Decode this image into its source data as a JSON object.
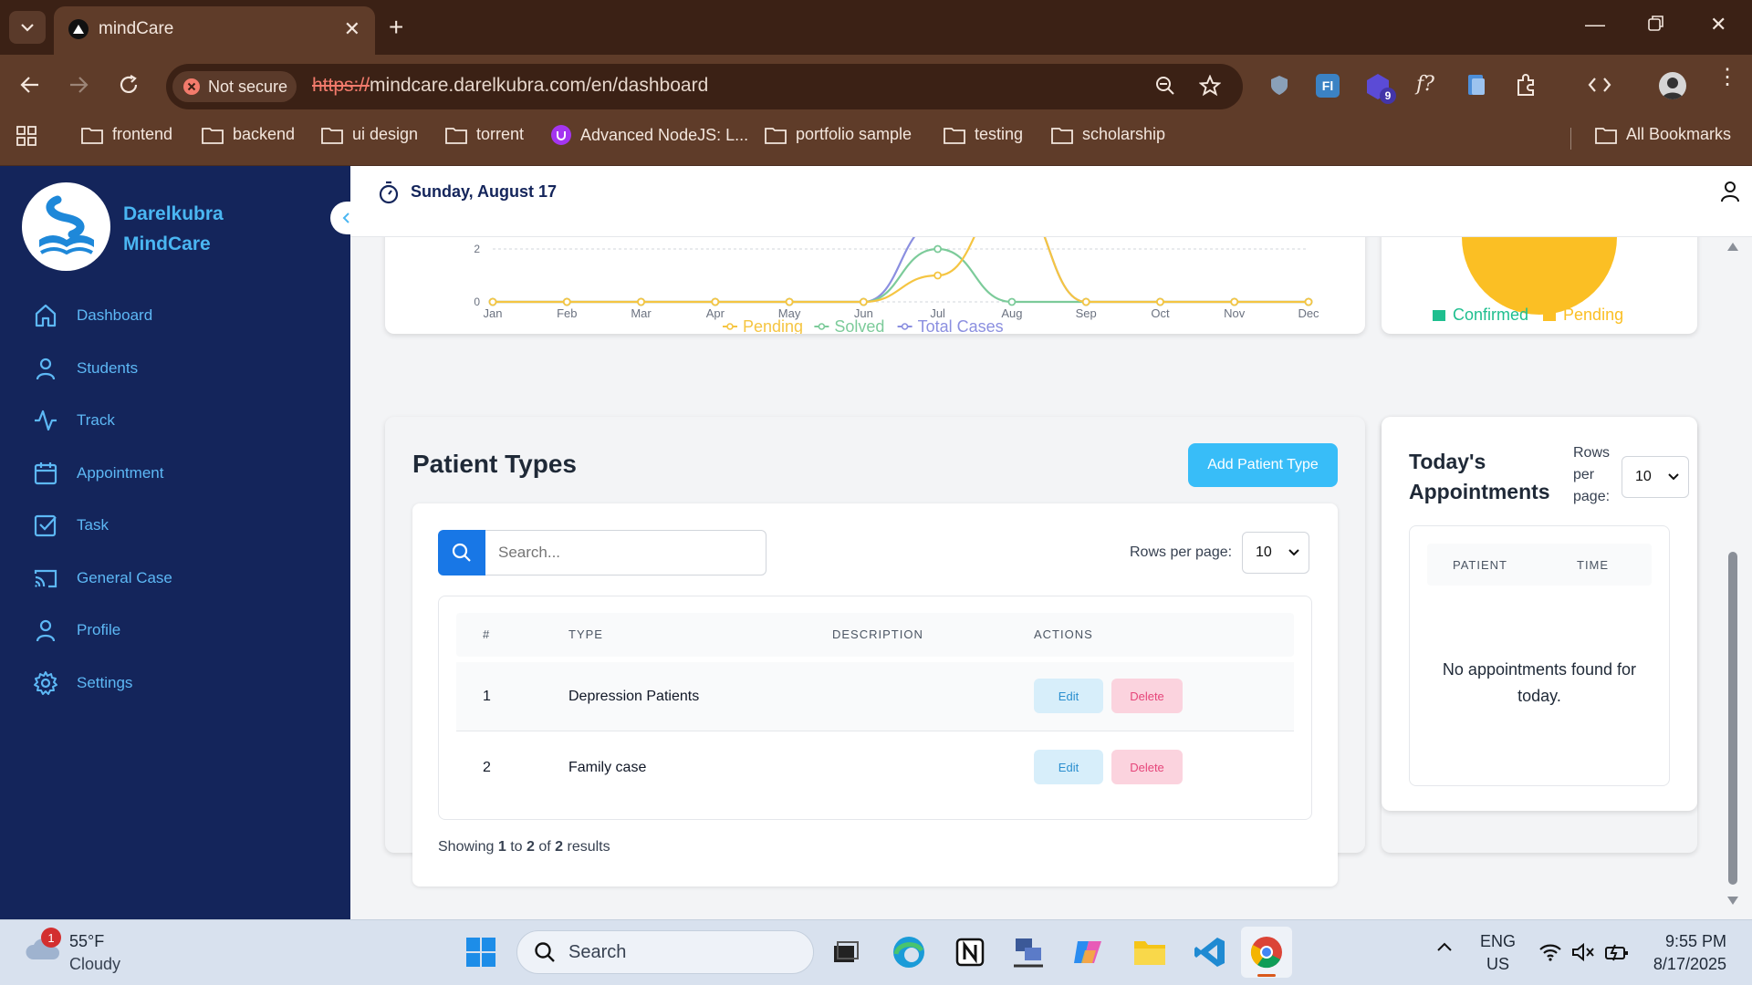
{
  "browser": {
    "tab_title": "mindCare",
    "security_label": "Not secure",
    "url_proto": "https://",
    "url_rest": "mindcare.darelkubra.com/en/dashboard",
    "extension_badge": "9",
    "bookmarks": [
      "frontend",
      "backend",
      "ui design",
      "torrent",
      "Advanced NodeJS: L...",
      "portfolio sample",
      "testing",
      "scholarship"
    ],
    "all_bookmarks": "All Bookmarks"
  },
  "sidebar": {
    "brand_line1": "Darelkubra",
    "brand_line2": "MindCare",
    "items": [
      {
        "label": "Dashboard",
        "icon": "home-icon"
      },
      {
        "label": "Students",
        "icon": "user-icon"
      },
      {
        "label": "Track",
        "icon": "activity-icon"
      },
      {
        "label": "Appointment",
        "icon": "calendar-icon"
      },
      {
        "label": "Task",
        "icon": "checkbox-icon"
      },
      {
        "label": "General Case",
        "icon": "cast-icon"
      },
      {
        "label": "Profile",
        "icon": "user-icon"
      },
      {
        "label": "Settings",
        "icon": "gear-icon"
      }
    ]
  },
  "header": {
    "date": "Sunday, August 17"
  },
  "chart_data": [
    {
      "type": "line",
      "x": [
        "Jan",
        "Feb",
        "Mar",
        "Apr",
        "May",
        "Jun",
        "Jul",
        "Aug",
        "Sep",
        "Oct",
        "Nov",
        "Dec"
      ],
      "ytick_labels": [
        "0",
        "2"
      ],
      "series": [
        {
          "name": "Pending",
          "color": "#f5c542",
          "values": [
            0,
            0,
            0,
            0,
            0,
            0,
            1,
            4,
            0,
            0,
            0,
            0
          ]
        },
        {
          "name": "Solved",
          "color": "#7ccb9a",
          "values": [
            0,
            0,
            0,
            0,
            0,
            0,
            2,
            0,
            0,
            0,
            0,
            0
          ]
        },
        {
          "name": "Total Cases",
          "color": "#8b8fe0",
          "values": [
            0,
            0,
            0,
            0,
            0,
            0,
            3,
            4,
            0,
            0,
            0,
            0
          ]
        }
      ],
      "legend": [
        "Pending",
        "Solved",
        "Total Cases"
      ],
      "grid": true
    },
    {
      "type": "pie",
      "legend": [
        "Confirmed",
        "Pending"
      ],
      "colors": {
        "Confirmed": "#1fbf8f",
        "Pending": "#fbbf24"
      }
    }
  ],
  "patient_types": {
    "title": "Patient Types",
    "add_button": "Add Patient Type",
    "search_placeholder": "Search...",
    "rows_label": "Rows per page:",
    "rows_value": "10",
    "columns": [
      "#",
      "TYPE",
      "DESCRIPTION",
      "ACTIONS"
    ],
    "rows": [
      {
        "num": "1",
        "type": "Depression Patients",
        "description": ""
      },
      {
        "num": "2",
        "type": "Family case",
        "description": ""
      }
    ],
    "edit_label": "Edit",
    "delete_label": "Delete",
    "footer": {
      "prefix": "Showing",
      "from": "1",
      "to_word": "to",
      "to": "2",
      "of_word": "of",
      "total": "2",
      "suffix": "results"
    }
  },
  "appointments": {
    "title_line1": "Today's",
    "title_line2": "Appointments",
    "rows_label_1": "Rows",
    "rows_label_2": "per",
    "rows_label_3": "page:",
    "rows_value": "10",
    "columns": [
      "PATIENT",
      "TIME"
    ],
    "empty_line1": "No appointments found for",
    "empty_line2": "today."
  },
  "taskbar": {
    "weather_badge": "1",
    "temp": "55°F",
    "condition": "Cloudy",
    "search_label": "Search",
    "lang": "ENG",
    "region": "US",
    "time": "9:55 PM",
    "date": "8/17/2025"
  }
}
